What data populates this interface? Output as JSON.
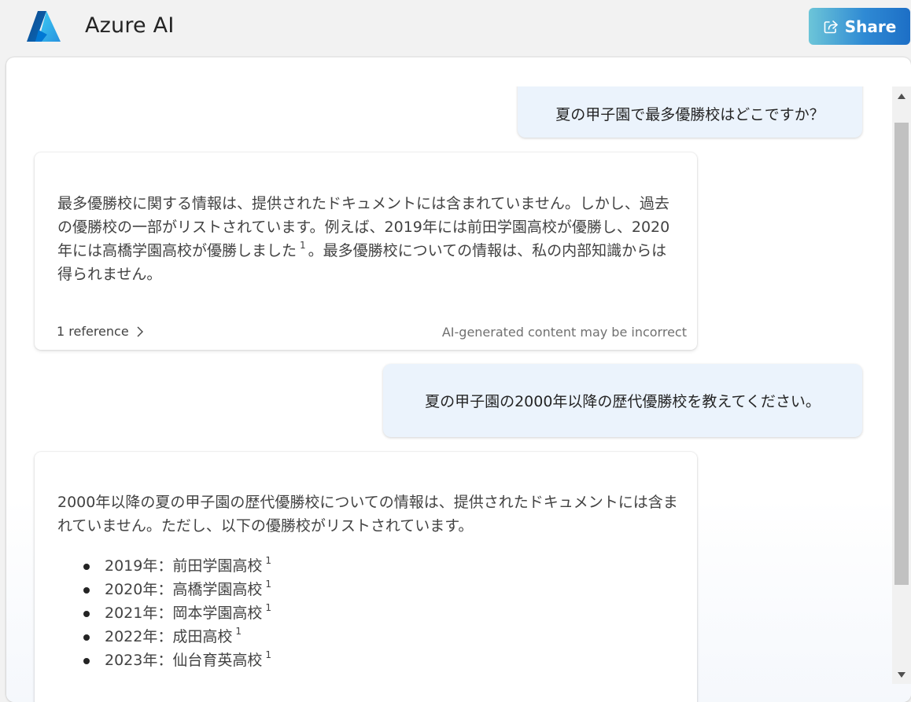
{
  "header": {
    "app_title": "Azure AI",
    "logo_icon": "azure-logo-icon",
    "share_label": "Share",
    "share_icon": "share-icon",
    "share_gradient": [
      "#6cc5d8",
      "#1d6fc6"
    ]
  },
  "conversation": [
    {
      "role": "user",
      "text": "夏の甲子園で最多優勝校はどこですか？"
    },
    {
      "role": "assistant",
      "paragraph_before": "最多優勝校に関する情報は、提供されたドキュメントには含まれていません。しかし、過去の優勝校の一部がリストされています。例えば、2019年には前田学園高校が優勝し、2020年には高橋学園高校が優勝しました",
      "citation": "1",
      "paragraph_after": "。最多優勝校についての情報は、私の内部知識からは得られません。",
      "references_label": "1 reference",
      "disclaimer": "AI-generated content may be incorrect"
    },
    {
      "role": "user",
      "text": "夏の甲子園の2000年以降の歴代優勝校を教えてください。"
    },
    {
      "role": "assistant",
      "paragraph": "2000年以降の夏の甲子園の歴代優勝校についての情報は、提供されたドキュメントには含まれていません。ただし、以下の優勝校がリストされています。",
      "list": [
        {
          "text": "2019年：前田学園高校",
          "citation": "1"
        },
        {
          "text": "2020年：高橋学園高校",
          "citation": "1"
        },
        {
          "text": "2021年：岡本学園高校",
          "citation": "1"
        },
        {
          "text": "2022年：成田高校",
          "citation": "1"
        },
        {
          "text": "2023年：仙台育英高校",
          "citation": "1"
        }
      ]
    }
  ],
  "colors": {
    "user_bubble": "#ebf3fc",
    "background": "#f2f2f2",
    "scroll_thumb": "#c1c1c1"
  }
}
